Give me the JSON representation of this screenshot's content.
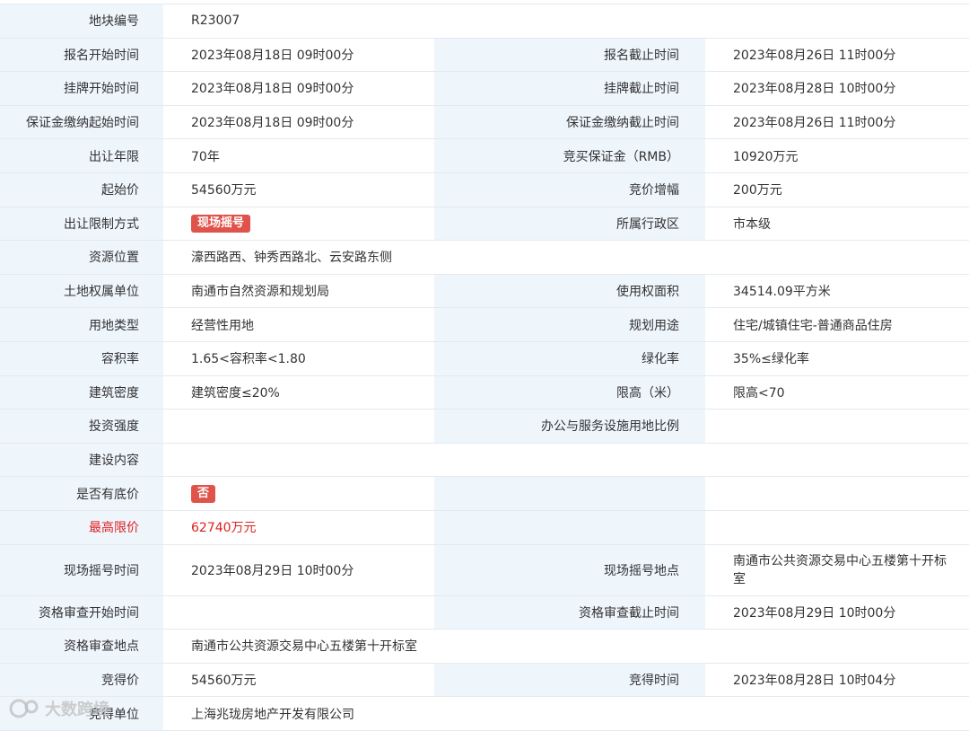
{
  "rows": {
    "parcel_no": {
      "label": "地块编号",
      "value": "R23007"
    },
    "signup_start": {
      "label": "报名开始时间",
      "value": "2023年08月18日 09时00分"
    },
    "signup_end": {
      "label": "报名截止时间",
      "value": "2023年08月26日 11时00分"
    },
    "listing_start": {
      "label": "挂牌开始时间",
      "value": "2023年08月18日 09时00分"
    },
    "listing_end": {
      "label": "挂牌截止时间",
      "value": "2023年08月28日 10时00分"
    },
    "deposit_start": {
      "label": "保证金缴纳起始时间",
      "value": "2023年08月18日 09时00分"
    },
    "deposit_end": {
      "label": "保证金缴纳截止时间",
      "value": "2023年08月26日 11时00分"
    },
    "term": {
      "label": "出让年限",
      "value": "70年"
    },
    "bid_deposit": {
      "label": "竞买保证金（RMB）",
      "value": "10920万元"
    },
    "start_price": {
      "label": "起始价",
      "value": "54560万元"
    },
    "increment": {
      "label": "竞价增幅",
      "value": "200万元"
    },
    "restriction_mode": {
      "label": "出让限制方式",
      "tag": "现场摇号"
    },
    "district": {
      "label": "所属行政区",
      "value": "市本级"
    },
    "location": {
      "label": "资源位置",
      "value": "濠西路西、钟秀西路北、云安路东侧"
    },
    "owner_unit": {
      "label": "土地权属单位",
      "value": "南通市自然资源和规划局"
    },
    "area": {
      "label": "使用权面积",
      "value": "34514.09平方米"
    },
    "land_type": {
      "label": "用地类型",
      "value": "经营性用地"
    },
    "planned_use": {
      "label": "规划用途",
      "value": "住宅/城镇住宅-普通商品住房"
    },
    "plot_ratio": {
      "label": "容积率",
      "value": "1.65<容积率<1.80"
    },
    "green_ratio": {
      "label": "绿化率",
      "value": "35%≤绿化率"
    },
    "building_density": {
      "label": "建筑密度",
      "value": "建筑密度≤20%"
    },
    "height_limit": {
      "label": "限高（米）",
      "value": "限高<70"
    },
    "invest_intensity": {
      "label": "投资强度",
      "value": ""
    },
    "office_ratio": {
      "label": "办公与服务设施用地比例",
      "value": ""
    },
    "construction": {
      "label": "建设内容",
      "value": ""
    },
    "reserve_price": {
      "label": "是否有底价",
      "tag": "否"
    },
    "max_price": {
      "label": "最高限价",
      "value": "62740万元"
    },
    "lottery_time": {
      "label": "现场摇号时间",
      "value": "2023年08月29日 10时00分"
    },
    "lottery_place": {
      "label": "现场摇号地点",
      "value": "南通市公共资源交易中心五楼第十开标室"
    },
    "review_start": {
      "label": "资格审查开始时间",
      "value": ""
    },
    "review_end": {
      "label": "资格审查截止时间",
      "value": "2023年08月29日 10时00分"
    },
    "review_place": {
      "label": "资格审查地点",
      "value": "南通市公共资源交易中心五楼第十开标室"
    },
    "deal_price": {
      "label": "竞得价",
      "value": "54560万元"
    },
    "deal_time": {
      "label": "竞得时间",
      "value": "2023年08月28日 10时04分"
    },
    "winner": {
      "label": "竞得单位",
      "value": "上海兆珑房地产开发有限公司"
    }
  },
  "colors": {
    "label_bg": "#eef5fb",
    "border": "#e4eaf0",
    "tag_bg": "#e0534a",
    "highlight": "#e02020"
  },
  "watermark": {
    "icon": "dashu-logo-icon",
    "text": "大数跨境"
  }
}
